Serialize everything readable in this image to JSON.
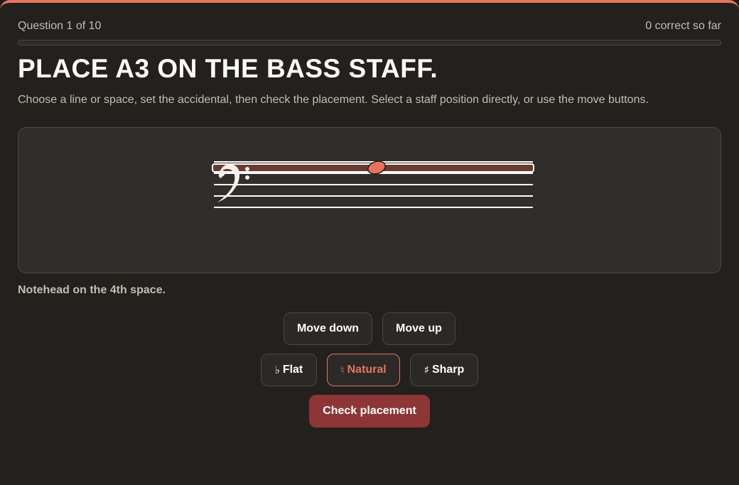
{
  "header": {
    "question_counter": "Question 1 of 10",
    "score": "0 correct so far",
    "progress": 0
  },
  "prompt": {
    "title": "PLACE A3 ON THE BASS STAFF.",
    "instructions": "Choose a line or space, set the accidental, then check the placement. Select a staff position directly, or use the move buttons."
  },
  "staff": {
    "clef": "bass-clef-icon",
    "line_count": 5,
    "selected_position": "4th space",
    "note_color": "#e8735a",
    "highlight_color": "#6b3a2e"
  },
  "status_text": "Notehead on the 4th space.",
  "controls": {
    "move_down": "Move down",
    "move_up": "Move up",
    "flat_glyph": "♭",
    "flat_label": "Flat",
    "natural_glyph": "♮",
    "natural_label": "Natural",
    "sharp_glyph": "♯",
    "sharp_label": "Sharp",
    "selected_accidental": "natural",
    "check_label": "Check placement"
  },
  "colors": {
    "accent": "#e8735a",
    "primary_button": "#8e3535"
  }
}
